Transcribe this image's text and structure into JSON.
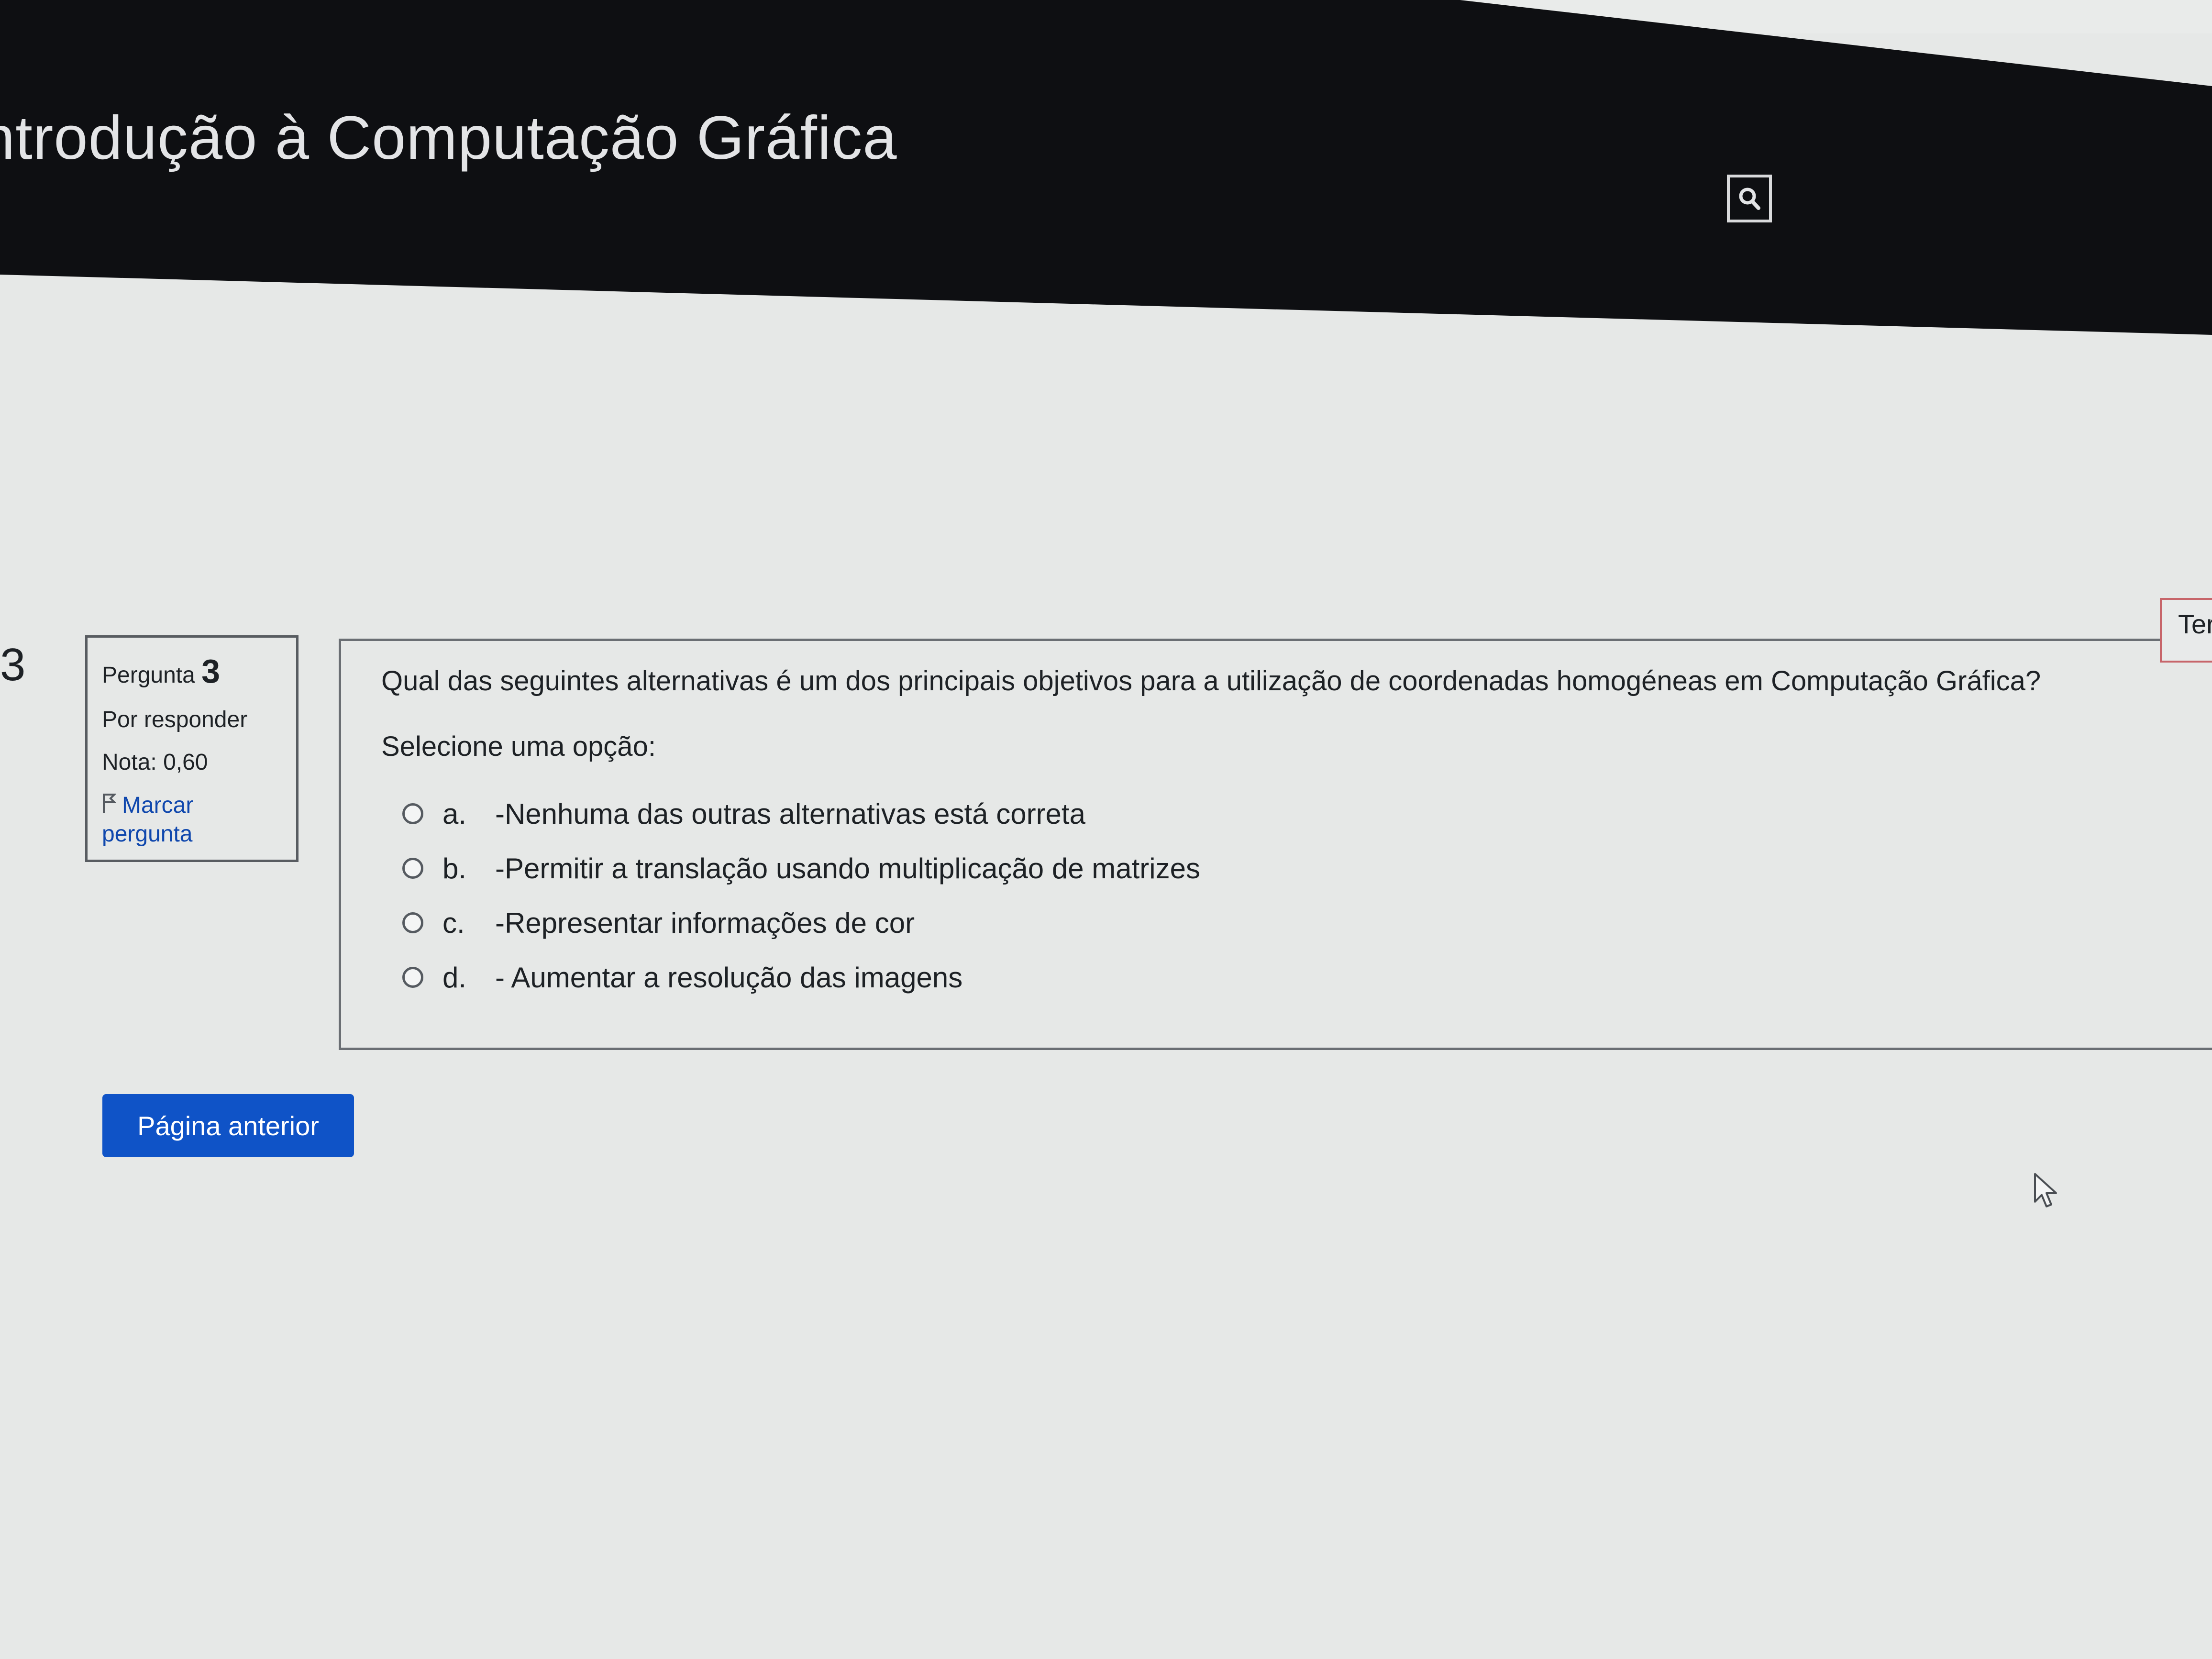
{
  "header": {
    "title": "ntrodução à Computação Gráfica",
    "search_icon": "search-icon",
    "bg_color": "#0e0f12"
  },
  "sidebar_number": "3",
  "question_info": {
    "label": "Pergunta",
    "number": "3",
    "status": "Por responder",
    "grade": "Nota: 0,60",
    "flag_label": "Marcar pergunta",
    "flag_icon": "flag-icon"
  },
  "question": {
    "text": "Qual das seguintes alternativas é um dos principais objetivos para a utilização de coordenadas homogéneas em Computação Gráfica?",
    "prompt": "Selecione uma opção:",
    "options": [
      {
        "letter": "a.",
        "text": "-Nenhuma das outras alternativas está correta"
      },
      {
        "letter": "b.",
        "text": "-Permitir a translação usando multiplicação de matrizes"
      },
      {
        "letter": "c.",
        "text": "-Representar informações de cor"
      },
      {
        "letter": "d.",
        "text": "- Aumentar a resolução das imagens"
      }
    ]
  },
  "timer": {
    "label": "Ter"
  },
  "navigation": {
    "previous_label": "Página anterior",
    "accent_color": "#0f53c7"
  }
}
